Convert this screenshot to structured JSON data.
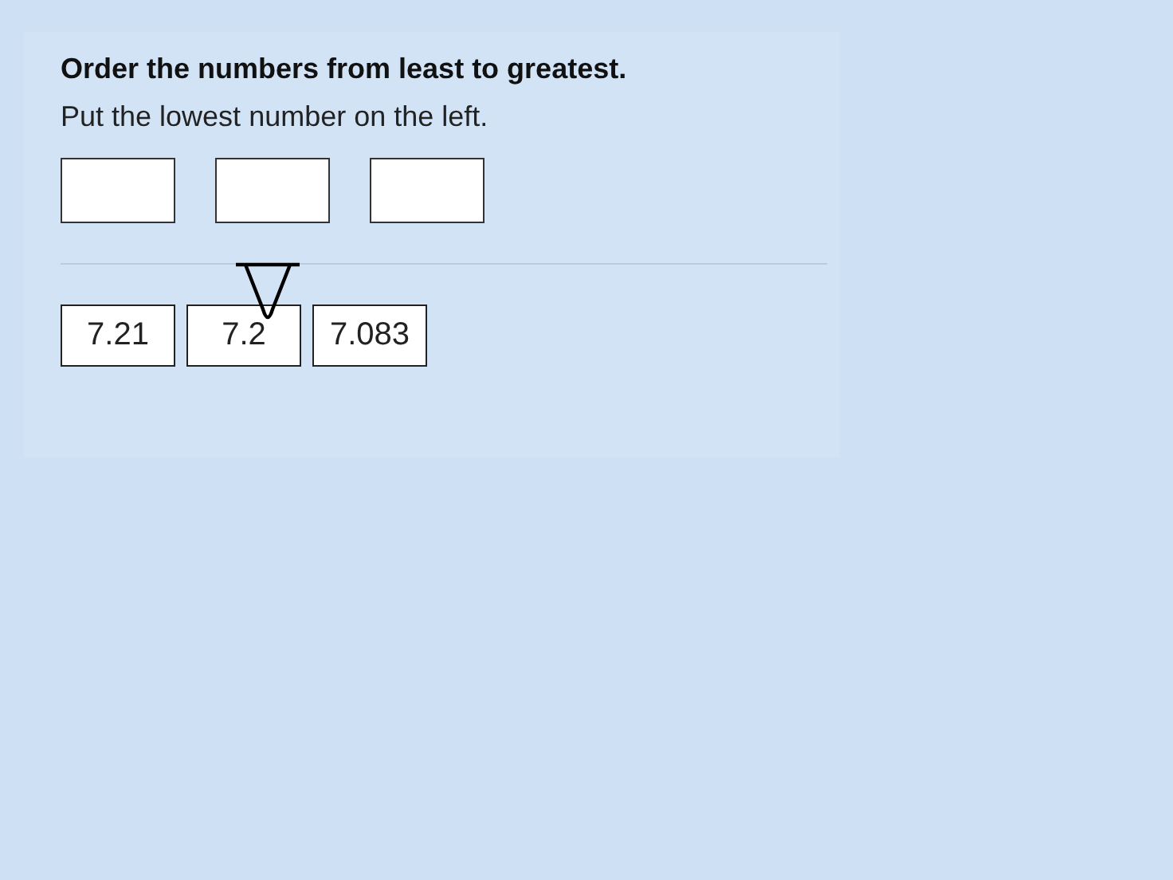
{
  "instruction": "Order the numbers from least to greatest.",
  "hint": "Put the lowest number on the left.",
  "slots": [
    {
      "filled": false
    },
    {
      "filled": false
    },
    {
      "filled": false
    }
  ],
  "tiles": [
    "7.21",
    "7.2",
    "7.083"
  ]
}
